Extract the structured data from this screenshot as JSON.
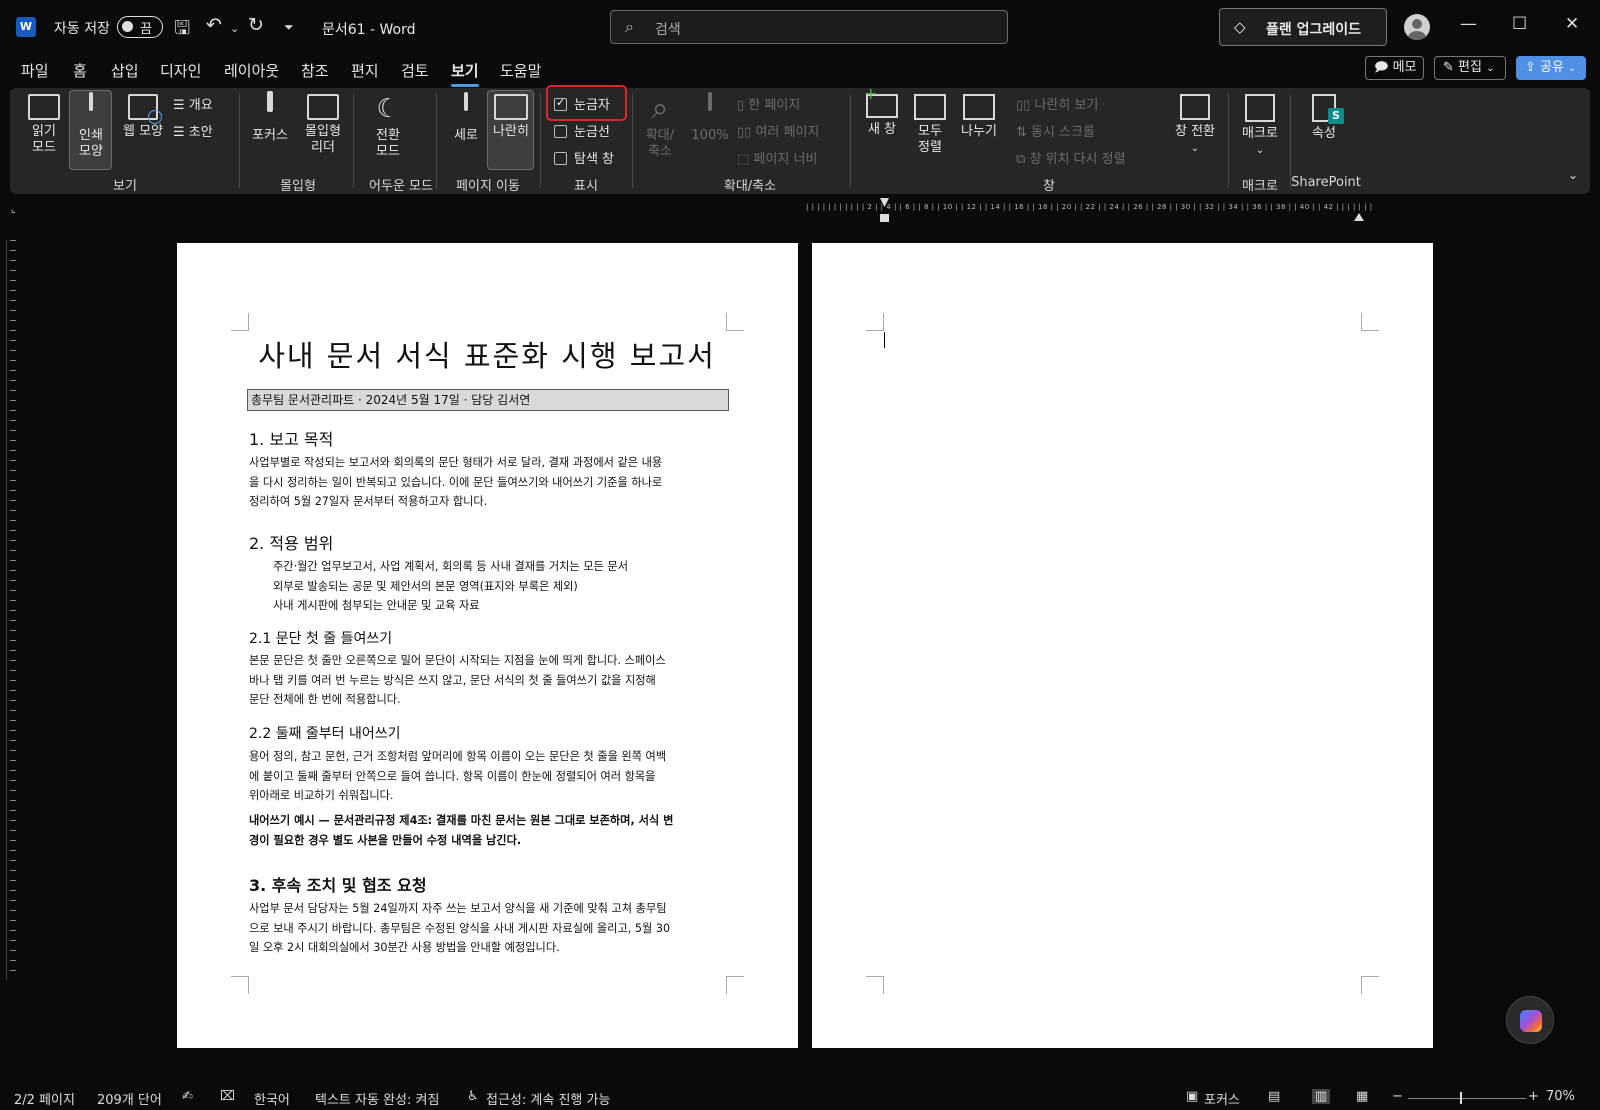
{
  "titlebar": {
    "autosave_label": "자동 저장",
    "autosave_state": "끔",
    "doc_title": "문서61 - Word",
    "search_placeholder": "검색",
    "upgrade_label": "플랜 업그레이드"
  },
  "menu": {
    "tabs": [
      "파일",
      "홈",
      "삽입",
      "디자인",
      "레이아웃",
      "참조",
      "편지",
      "검토",
      "보기",
      "도움말"
    ],
    "active_tab": "보기",
    "memo_label": "메모",
    "edit_label": "편집",
    "share_label": "공유"
  },
  "ribbon": {
    "view_group": {
      "label": "보기",
      "read_mode": "읽기 모드",
      "read_mode_l1": "읽기",
      "read_mode_l2": "모드",
      "print_l1": "인쇄",
      "print_l2": "모양",
      "web_layout": "웹 모양",
      "outline": "개요",
      "draft": "초안"
    },
    "immersive_group": {
      "label": "몰입형",
      "focus": "포커스",
      "reader_l1": "몰입형",
      "reader_l2": "리더"
    },
    "dark_group": {
      "label": "어두운 모드",
      "switch_l1": "전환",
      "switch_l2": "모드"
    },
    "page_move_group": {
      "label": "페이지 이동",
      "vertical": "세로",
      "side_by_side": "나란히"
    },
    "show_group": {
      "label": "표시",
      "ruler": "눈금자",
      "gridlines": "눈금선",
      "nav_pane": "탐색 창"
    },
    "zoom_group": {
      "label": "확대/축소",
      "zoom_l1": "확대/",
      "zoom_l2": "축소",
      "hundred": "100%",
      "one_page": "한 페이지",
      "multi_page": "여러 페이지",
      "page_width": "페이지 너비"
    },
    "window_group": {
      "label": "창",
      "new_window": "새 창",
      "arrange_l1": "모두",
      "arrange_l2": "정렬",
      "split": "나누기",
      "side_view": "나란히 보기",
      "sync_scroll": "동시 스크롤",
      "reset_pos": "창 위치 다시 정렬",
      "switch_window": "창 전환"
    },
    "macro_group": {
      "label": "매크로",
      "macros": "매크로"
    },
    "sharepoint_group": {
      "label": "SharePoint",
      "properties": "속성"
    }
  },
  "document": {
    "title": "사내 문서 서식 표준화 시행 보고서",
    "meta": "총무팀 문서관리파트 · 2024년 5월 17일 · 담당 김서연",
    "s1_heading": "1. 보고 목적",
    "s1_body": [
      "사업부별로 작성되는 보고서와 회의록의 문단 형태가 서로 달라, 결재 과정에서 같은 내용",
      "을 다시 정리하는 일이 반복되고 있습니다. 이에 문단 들여쓰기와 내어쓰기 기준을 하나로",
      "정리하여 5월 27일자 문서부터 적용하고자 합니다."
    ],
    "s2_heading": "2. 적용 범위",
    "s2_items": [
      "주간·월간 업무보고서, 사업 계획서, 회의록 등 사내 결재를 거치는 모든 문서",
      "외부로 발송되는 공문 및 제안서의 본문 영역(표지와 부록은 제외)",
      "사내 게시판에 첨부되는 안내문 및 교육 자료"
    ],
    "s21_heading": "2.1 문단 첫 줄 들여쓰기",
    "s21_body": [
      "본문 문단은 첫 줄만 오른쪽으로 밀어 문단이 시작되는 지점을 눈에 띄게 합니다. 스페이스",
      "바나 탭 키를 여러 번 누르는 방식은 쓰지 않고, 문단 서식의 첫 줄 들여쓰기 값을 지정해",
      "문단 전체에 한 번에 적용합니다."
    ],
    "s22_heading": "2.2 둘째 줄부터 내어쓰기",
    "s22_body": [
      "용어 정의, 참고 문헌, 근거 조항처럼 앞머리에 항목 이름이 오는 문단은 첫 줄을 왼쪽 여백",
      "에 붙이고 둘째 줄부터 안쪽으로 들여 씁니다. 항목 이름이 한눈에 정렬되어 여러 항목을",
      "위아래로 비교하기 쉬워집니다."
    ],
    "example": [
      "내어쓰기 예시 — 문서관리규정 제4조: 결재를 마친 문서는 원본 그대로 보존하며, 서식 변",
      "경이 필요한 경우 별도 사본을 만들어 수정 내역을 남긴다."
    ],
    "s3_heading": "3. 후속 조치 및 협조 요청",
    "s3_body": [
      "사업부 문서 담당자는 5월 24일까지 자주 쓰는 보고서 양식을 새 기준에 맞춰 고쳐 총무팀",
      "으로 보내 주시기 바랍니다. 총무팀은 수정된 양식을 사내 게시판 자료실에 올리고, 5월 30",
      "일 오후 2시 대회의실에서 30분간 사용 방법을 안내할 예정입니다."
    ]
  },
  "ruler_marks": "| | | | | | | | | | | 2 | | 4 | | 6 | | 8 | | 10 | | 12 | | 14 | | 16 | | 18 | | 20 | | 22 | | 24 | | 26 | | 28 | | 30 | | 32 | | 34 | | 36 | | 38 | | 40 | | 42 | | | | | | |",
  "status": {
    "page": "2/2 페이지",
    "words": "209개 단어",
    "language": "한국어",
    "autocomplete": "텍스트 자동 완성: 켜짐",
    "accessibility": "접근성: 계속 진행 가능",
    "focus": "포커스",
    "zoom": "70%"
  }
}
